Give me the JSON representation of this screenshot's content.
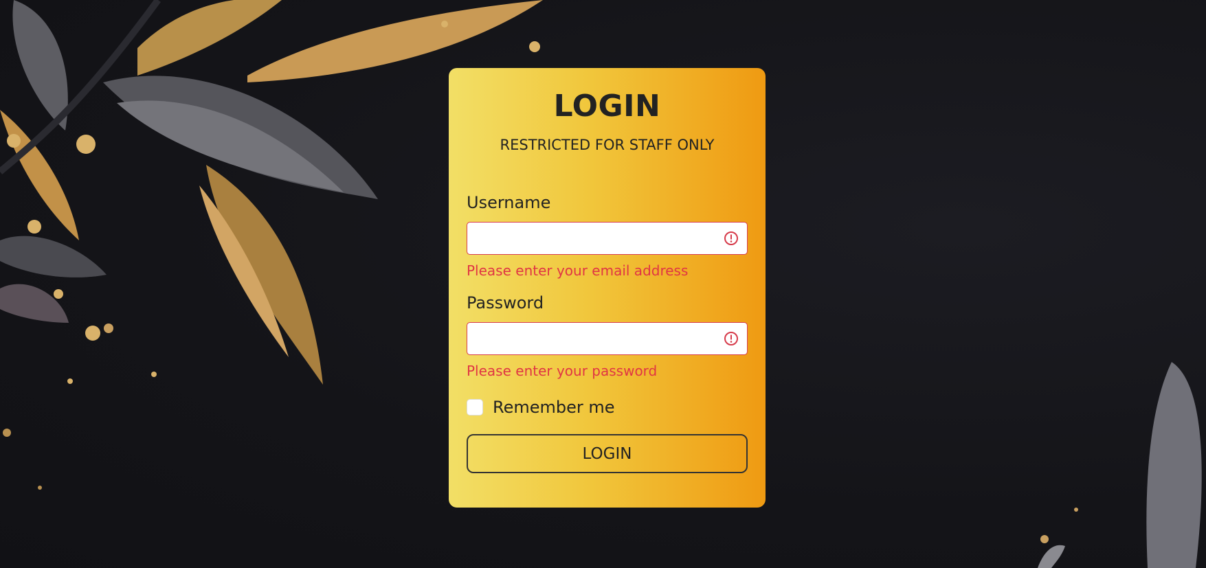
{
  "login": {
    "title": "LOGIN",
    "subtitle": "RESTRICTED FOR STAFF ONLY",
    "username_label": "Username",
    "username_value": "",
    "username_error": "Please enter your email address",
    "password_label": "Password",
    "password_value": "",
    "password_error": "Please enter your password",
    "remember_label": "Remember me",
    "remember_checked": false,
    "button_label": "LOGIN"
  },
  "colors": {
    "card_gradient_start": "#f2df66",
    "card_gradient_end": "#ef9a12",
    "error": "#e03544",
    "background": "#15151a"
  },
  "icons": {
    "field_status": "exclamation-circle-icon"
  }
}
